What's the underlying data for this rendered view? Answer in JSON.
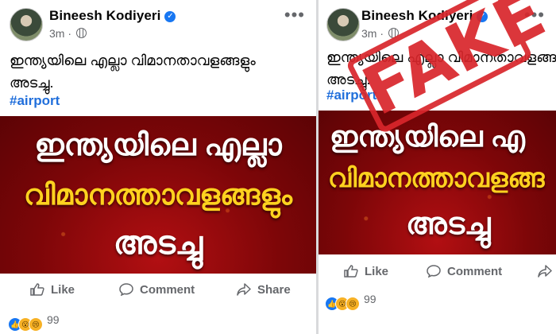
{
  "posts": [
    {
      "author": "Bineesh Kodiyeri",
      "time": "3m",
      "separator": "·",
      "caption_line1": "ഇന്ത്യയിലെ എല്ലാ വിമാനതാവളങ്ങളും",
      "caption_line2": "അടച്ചു.",
      "hashtag": "#airport",
      "banner_line1": "ഇന്ത്യയിലെ എല്ലാ",
      "banner_line2": "വിമാനത്താവളങ്ങളും",
      "banner_line3": "അടച്ചു",
      "like_label": "Like",
      "comment_label": "Comment",
      "share_label": "Share",
      "reaction_count": "99"
    },
    {
      "author": "Bineesh Kodiyeri",
      "time": "3m",
      "separator": "·",
      "caption_line1": "ഇന്ത്യയിലെ എല്ലാ വിമാനതാവളങ്ങ",
      "caption_line2": "അടച്ചു.",
      "hashtag": "#airport",
      "banner_line1": "ഇന്ത്യയിലെ എ",
      "banner_line2": "വിമാനത്താവളങ്ങ",
      "banner_line3": "അടച്ചു",
      "like_label": "Like",
      "comment_label": "Comment",
      "share_label": "",
      "reaction_count": "99"
    }
  ],
  "stamp": {
    "text": "FAKE",
    "color": "#d9262b"
  },
  "colors": {
    "banner_red": "#8a0709",
    "banner_yellow": "#ffd21f",
    "link_blue": "#216fdb",
    "verified_blue": "#1877f2"
  },
  "icons": [
    "verified-badge-icon",
    "globe-icon",
    "more-options-icon",
    "like-icon",
    "comment-icon",
    "share-icon",
    "like-reaction-icon",
    "wow-reaction-icon",
    "sad-reaction-icon"
  ]
}
